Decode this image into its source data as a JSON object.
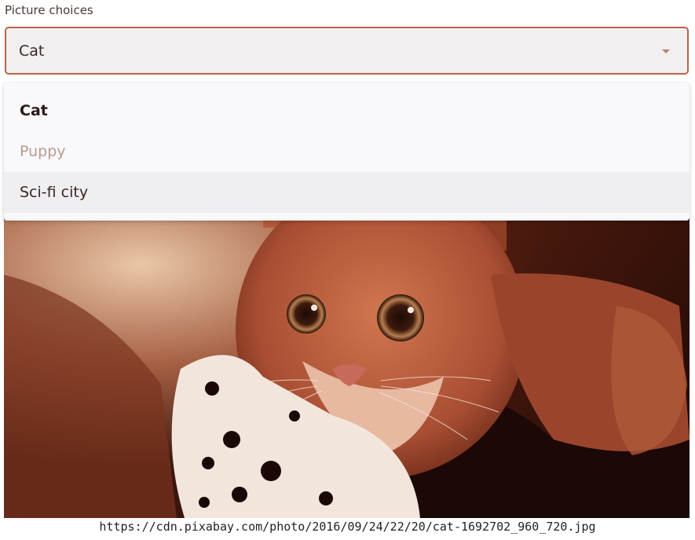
{
  "picker": {
    "label": "Picture choices",
    "selected": "Cat",
    "options": [
      {
        "label": "Cat",
        "state": "selected"
      },
      {
        "label": "Puppy",
        "state": "disabled"
      },
      {
        "label": "Sci-fi city",
        "state": "hovered"
      }
    ]
  },
  "image": {
    "subject": "orange tabby cat lying with a spotted toy",
    "caption_url": "https://cdn.pixabay.com/photo/2016/09/24/22/20/cat-1692702_960_720.jpg"
  },
  "colors": {
    "accent_border": "#b8644a",
    "disabled_text": "#b99a8e",
    "hover_background": "#efeef1"
  },
  "icons": {
    "select_caret": "chevron-down-icon"
  }
}
